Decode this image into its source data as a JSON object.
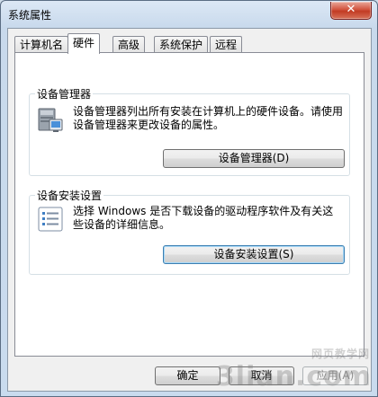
{
  "window": {
    "title": "系统属性",
    "close_glyph": "✕"
  },
  "tabs": [
    {
      "label": "计算机名",
      "active": false
    },
    {
      "label": "硬件",
      "active": true
    },
    {
      "label": "高级",
      "active": false
    },
    {
      "label": "系统保护",
      "active": false
    },
    {
      "label": "远程",
      "active": false
    }
  ],
  "device_manager": {
    "heading": "设备管理器",
    "description": "设备管理器列出所有安装在计算机上的硬件设备。请使用设备管理器来更改设备的属性。",
    "button_label": "设备管理器(D)"
  },
  "device_install": {
    "heading": "设备安装设置",
    "description": "选择 Windows 是否下载设备的驱动程序软件及有关这些设备的详细信息。",
    "button_label": "设备安装设置(S)"
  },
  "footer": {
    "ok_label": "确定",
    "cancel_label": "取消",
    "apply_label": "应用(A)"
  },
  "watermark": {
    "text": "3lian.com",
    "subtext": "网页教学网"
  }
}
